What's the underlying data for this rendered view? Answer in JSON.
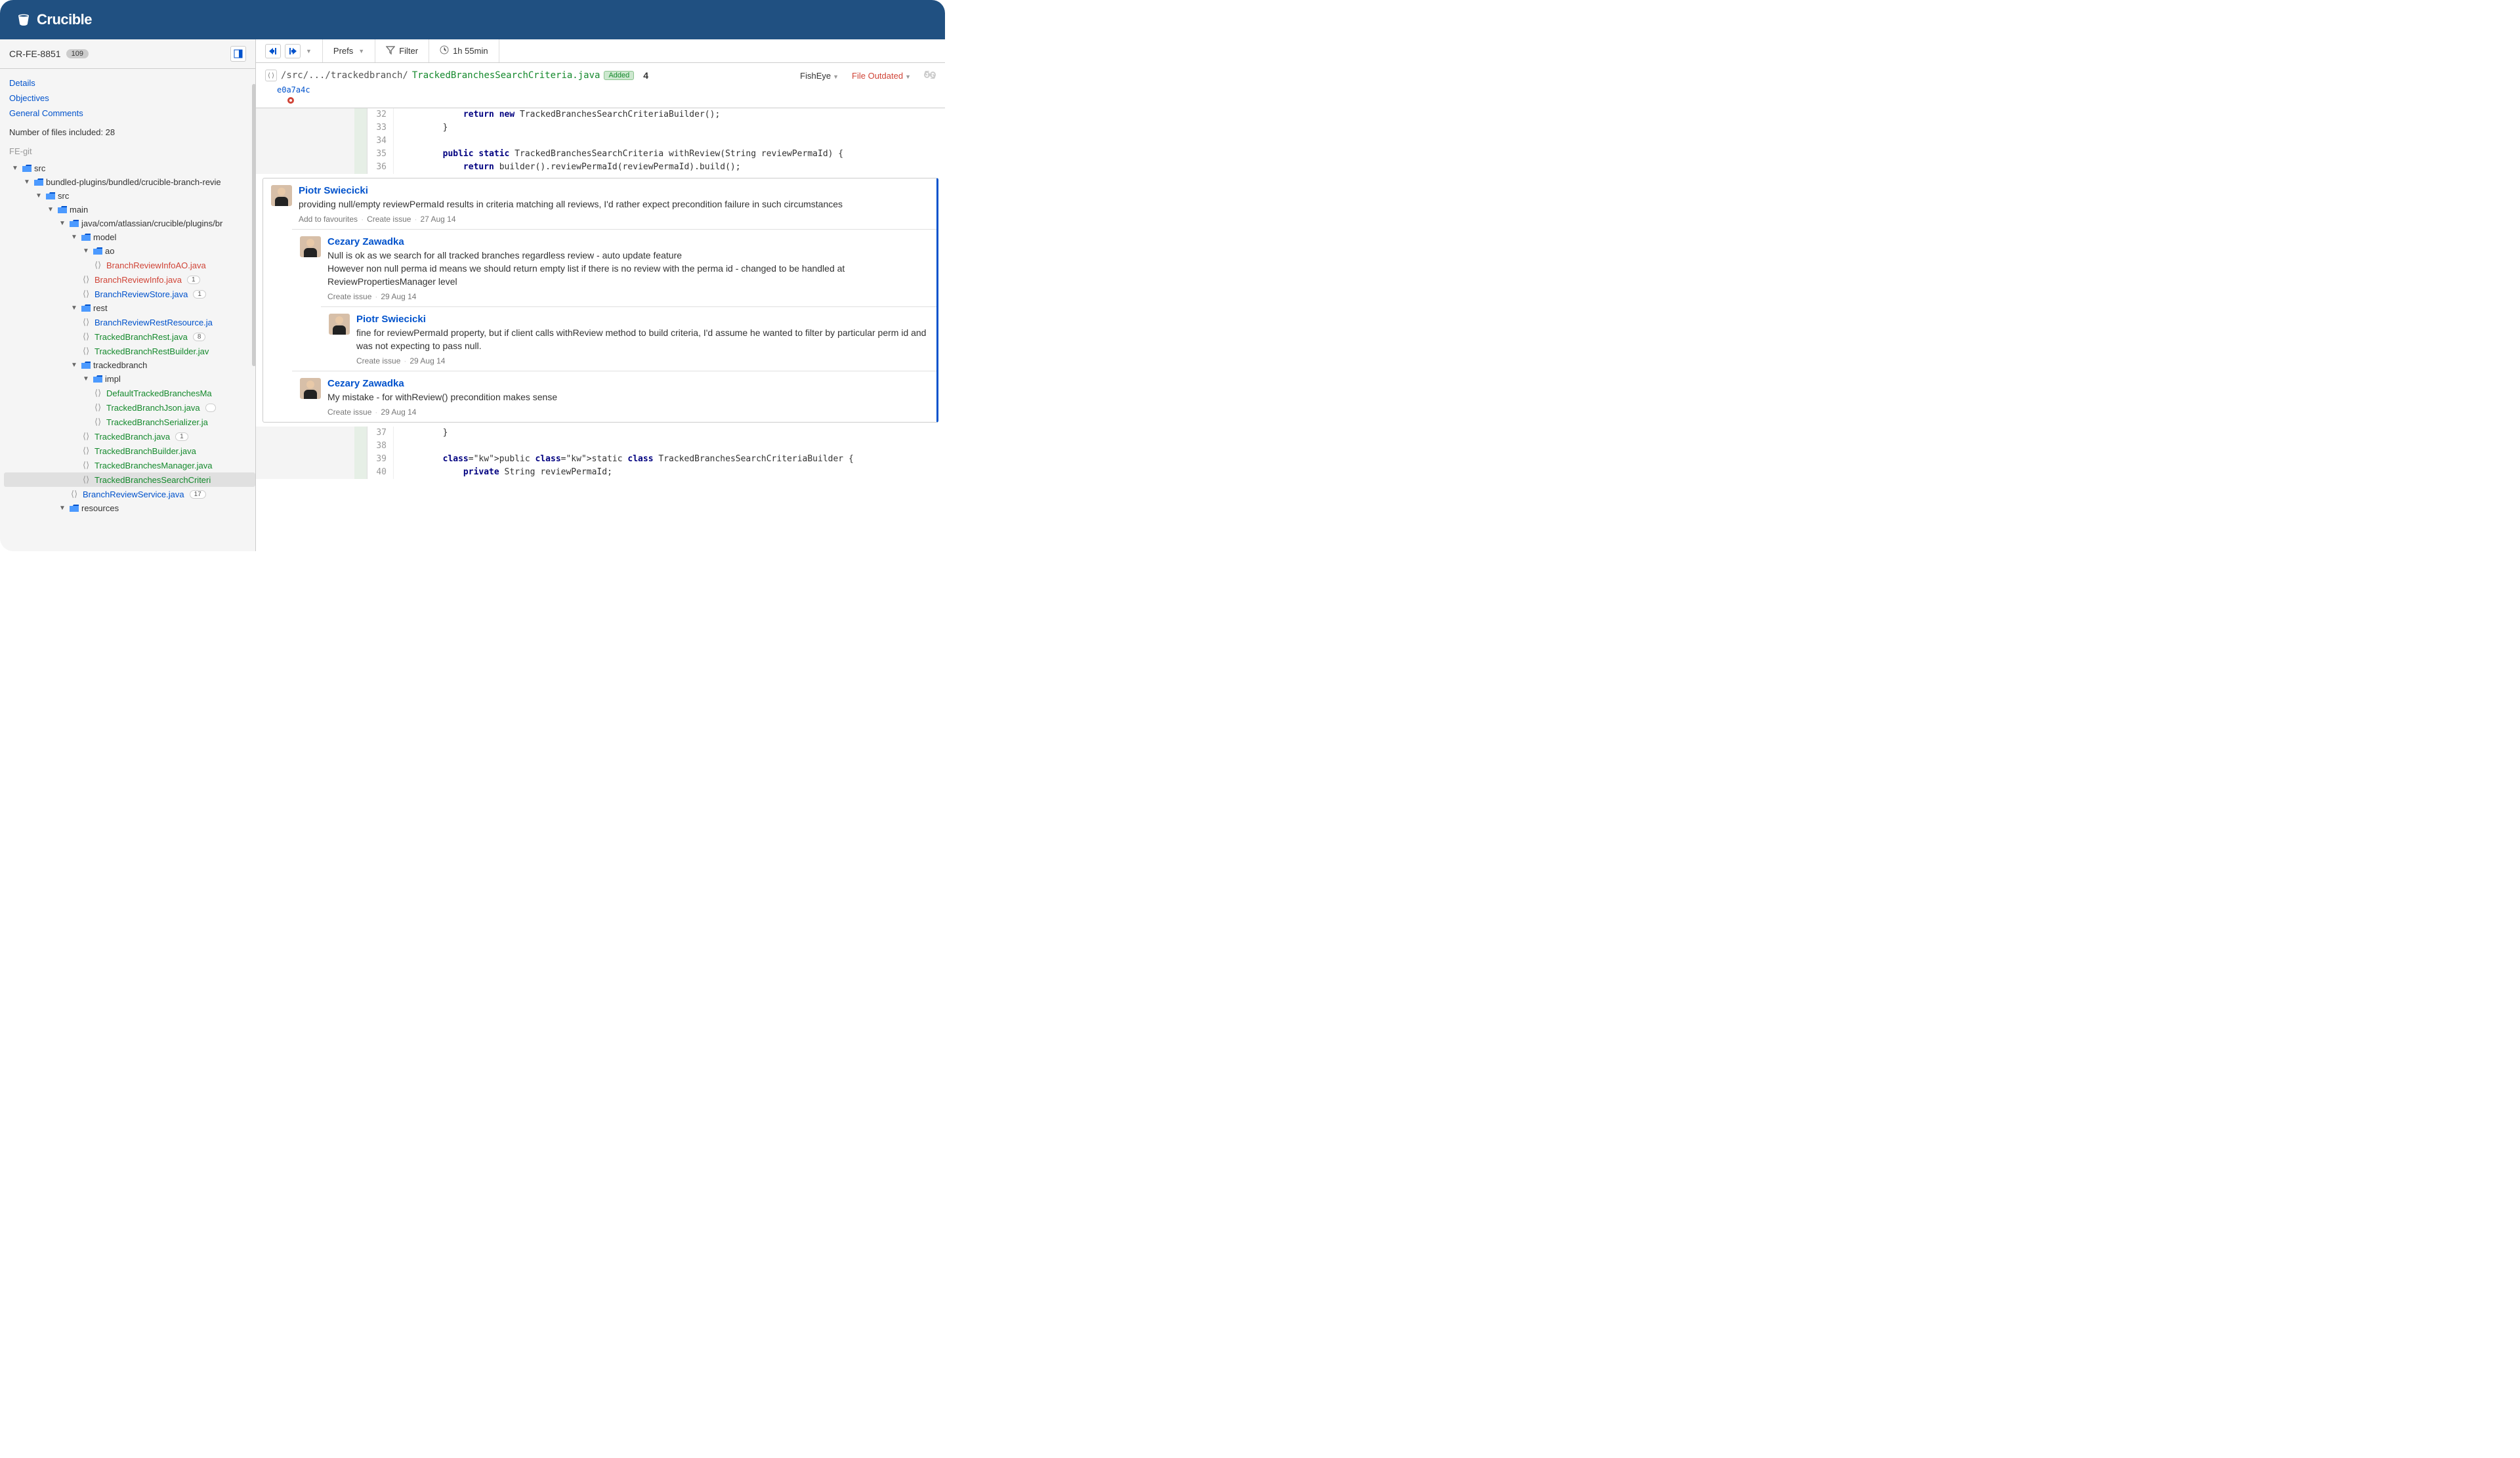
{
  "brand": "Crucible",
  "review": {
    "id": "CR-FE-8851",
    "count": "109"
  },
  "sidebarLinks": {
    "details": "Details",
    "objectives": "Objectives",
    "generalComments": "General Comments",
    "filesIncluded": "Number of files included: 28",
    "repo": "FE-git"
  },
  "tree": {
    "src": "src",
    "bundled": "bundled-plugins/bundled/crucible-branch-revie",
    "src2": "src",
    "main": "main",
    "javapath": "java/com/atlassian/crucible/plugins/br",
    "model": "model",
    "ao": "ao",
    "f_branchReviewInfoAO": "BranchReviewInfoAO.java",
    "f_branchReviewInfo": "BranchReviewInfo.java",
    "b_branchReviewInfo": "1",
    "f_branchReviewStore": "BranchReviewStore.java",
    "b_branchReviewStore": "1",
    "rest": "rest",
    "f_branchReviewRestResource": "BranchReviewRestResource.ja",
    "f_trackedBranchRest": "TrackedBranchRest.java",
    "b_trackedBranchRest": "8",
    "f_trackedBranchRestBuilder": "TrackedBranchRestBuilder.jav",
    "trackedbranch": "trackedbranch",
    "impl": "impl",
    "f_defaultTrackedBranchesMa": "DefaultTrackedBranchesMa",
    "f_trackedBranchJson": "TrackedBranchJson.java",
    "f_trackedBranchSerializer": "TrackedBranchSerializer.ja",
    "f_trackedBranch": "TrackedBranch.java",
    "b_trackedBranch": "1",
    "f_trackedBranchBuilder": "TrackedBranchBuilder.java",
    "f_trackedBranchesManager": "TrackedBranchesManager.java",
    "f_trackedBranchesSearchCriteria": "TrackedBranchesSearchCriteri",
    "f_branchReviewService": "BranchReviewService.java",
    "b_branchReviewService": "17",
    "resources": "resources"
  },
  "toolbar": {
    "prefs": "Prefs",
    "filter": "Filter",
    "time": "1h 55min"
  },
  "fileHeader": {
    "pathPrefix": "/src/.../trackedbranch/",
    "fileName": "TrackedBranchesSearchCriteria.java",
    "status": "Added",
    "commentCount": "4",
    "fisheye": "FishEye",
    "outdated": "File Outdated",
    "commit": "e0a7a4c"
  },
  "code1": [
    {
      "n": "32",
      "text": "            return new TrackedBranchesSearchCriteriaBuilder();",
      "kw": [
        "return",
        "new"
      ]
    },
    {
      "n": "33",
      "text": "        }"
    },
    {
      "n": "34",
      "text": ""
    },
    {
      "n": "35",
      "text": "        public static TrackedBranchesSearchCriteria withReview(String reviewPermaId) {",
      "kw": [
        "public",
        "static"
      ]
    },
    {
      "n": "36",
      "text": "            return builder().reviewPermaId(reviewPermaId).build();",
      "kw": [
        "return"
      ]
    }
  ],
  "comments": [
    {
      "author": "Piotr Swiecicki",
      "text": "providing null/empty reviewPermaId results in criteria matching all reviews, I'd rather expect precondition failure in such circumstances",
      "actions": [
        "Add to favourites",
        "Create issue"
      ],
      "date": "27 Aug 14",
      "nest": 0
    },
    {
      "author": "Cezary Zawadka",
      "text": "Null is ok as we search for all tracked branches regardless review - auto update feature\nHowever non null perma id means we should return empty list if there is no review with the perma id - changed to be handled at ReviewPropertiesManager level",
      "actions": [
        "Create issue"
      ],
      "date": "29 Aug 14",
      "nest": 1
    },
    {
      "author": "Piotr Swiecicki",
      "text": "fine for reviewPermaId property, but if client calls withReview method to build criteria, I'd assume he wanted to filter by particular perm id and was not expecting to pass null.",
      "actions": [
        "Create issue"
      ],
      "date": "29 Aug 14",
      "nest": 2
    },
    {
      "author": "Cezary Zawadka",
      "text": "My mistake - for withReview() precondition makes sense",
      "actions": [
        "Create issue"
      ],
      "date": "29 Aug 14",
      "nest": 1
    }
  ],
  "code2": [
    {
      "n": "37",
      "text": "        }"
    },
    {
      "n": "38",
      "text": ""
    },
    {
      "n": "39",
      "text": "        public static class TrackedBranchesSearchCriteriaBuilder {",
      "kw": [
        "public",
        "static",
        "class"
      ]
    },
    {
      "n": "40",
      "text": "            private String reviewPermaId;",
      "kw": [
        "private"
      ]
    }
  ]
}
